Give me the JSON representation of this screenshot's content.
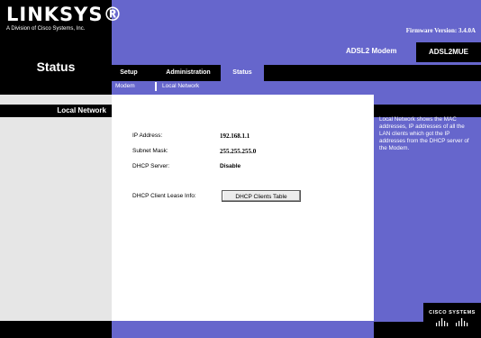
{
  "header": {
    "logo": "LINKSYS®",
    "logo_sub": "A Division of Cisco Systems, Inc.",
    "firmware": "Firmware Version: 3.4.0A",
    "product_name": "ADSL2 Modem",
    "model": "ADSL2MUE",
    "page_title": "Status"
  },
  "tabs": [
    {
      "label": "Setup"
    },
    {
      "label": "Administration"
    },
    {
      "label": "Status",
      "active": true
    }
  ],
  "subnav": [
    {
      "label": "Modem"
    },
    {
      "label": "Local Network",
      "active": true
    }
  ],
  "section": {
    "title": "Local Network"
  },
  "info": {
    "ip_label": "IP Address:",
    "ip_value": "192.168.1.1",
    "mask_label": "Subnet Mask:",
    "mask_value": "255.255.255.0",
    "dhcp_label": "DHCP Server:",
    "dhcp_value": "Disable",
    "lease_label": "DHCP Client Lease Info:",
    "lease_button": "DHCP Clients Table"
  },
  "help": {
    "text": "Local Network shows the MAC addresses, IP addresses of all the LAN clients which got the IP addresses from the DHCP server of the Modem."
  },
  "footer": {
    "cisco": "CISCO SYSTEMS"
  },
  "colors": {
    "accent": "#6666cc",
    "dark": "#000000",
    "panel": "#e6e6e6"
  }
}
